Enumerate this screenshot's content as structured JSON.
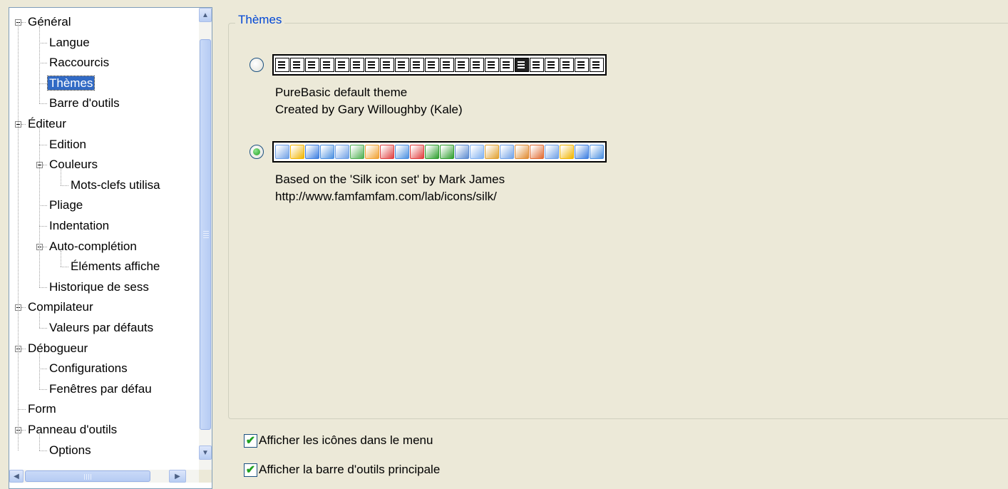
{
  "tree": {
    "items": [
      {
        "label": "Général",
        "level": 0,
        "expander": true
      },
      {
        "label": "Langue",
        "level": 1
      },
      {
        "label": "Raccourcis",
        "level": 1
      },
      {
        "label": "Thèmes",
        "level": 1,
        "selected": true
      },
      {
        "label": "Barre d'outils",
        "level": 1
      },
      {
        "label": "Éditeur",
        "level": 0,
        "expander": true
      },
      {
        "label": "Edition",
        "level": 1
      },
      {
        "label": "Couleurs",
        "level": 1,
        "expander": true
      },
      {
        "label": "Mots-clefs utilisa",
        "level": 2
      },
      {
        "label": "Pliage",
        "level": 1
      },
      {
        "label": "Indentation",
        "level": 1
      },
      {
        "label": "Auto-complétion",
        "level": 1,
        "expander": true
      },
      {
        "label": "Éléments affiche",
        "level": 2
      },
      {
        "label": "Historique de sess",
        "level": 1
      },
      {
        "label": "Compilateur",
        "level": 0,
        "expander": true
      },
      {
        "label": "Valeurs par défauts",
        "level": 1
      },
      {
        "label": "Débogueur",
        "level": 0,
        "expander": true
      },
      {
        "label": "Configurations",
        "level": 1
      },
      {
        "label": "Fenêtres par défau",
        "level": 1
      },
      {
        "label": "Form",
        "level": 0
      },
      {
        "label": "Panneau d'outils",
        "level": 0,
        "expander": true
      },
      {
        "label": "Options",
        "level": 1
      }
    ]
  },
  "themes": {
    "group_title": "Thèmes",
    "options": [
      {
        "selected": false,
        "style": "mono",
        "icon_count": 22,
        "description": [
          "PureBasic default theme",
          "Created by Gary Willoughby (Kale)"
        ]
      },
      {
        "selected": true,
        "style": "silk",
        "icon_count": 22,
        "description": [
          "Based on the 'Silk icon set' by Mark James",
          "http://www.famfamfam.com/lab/icons/silk/"
        ]
      }
    ]
  },
  "options": {
    "show_menu_icons": {
      "label": "Afficher les icônes dans le menu",
      "checked": true
    },
    "show_main_toolbar": {
      "label": "Afficher la barre d'outils principale",
      "checked": true
    }
  },
  "colors": {
    "accent": "#0046d5",
    "selection": "#316ac5",
    "checkmark": "#21a121"
  }
}
